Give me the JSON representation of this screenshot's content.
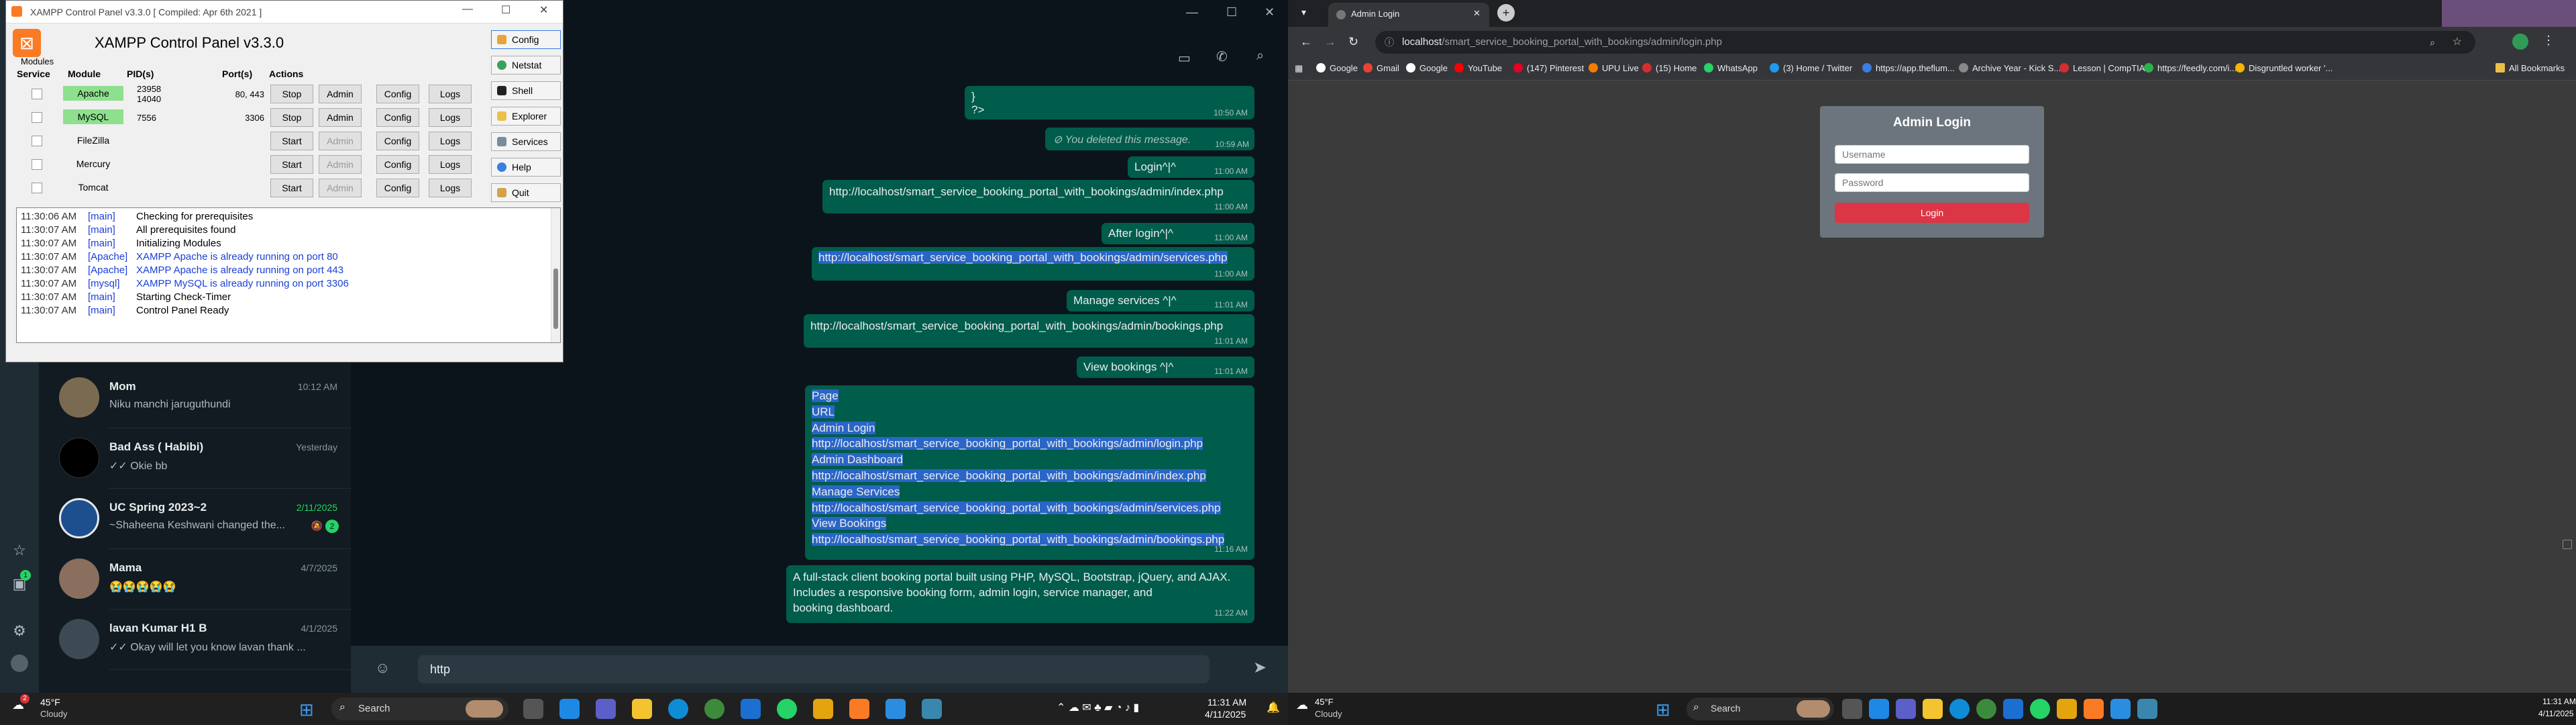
{
  "whatsapp": {
    "rail_badge": "1",
    "chats": [
      {
        "name": "Mom",
        "preview": "Niku manchi jaruguthundi",
        "time": "10:12 AM"
      },
      {
        "name": "Bad Ass ( Habibi)",
        "preview": "✓✓ Okie bb",
        "time": "Yesterday"
      },
      {
        "name": "UC Spring 2023~2",
        "preview": "~Shaheena Keshwani changed the...",
        "time": "2/11/2025",
        "badge": "2"
      },
      {
        "name": "Mama",
        "preview": "😭😭😭😭😭",
        "time": "4/7/2025"
      },
      {
        "name": "lavan Kumar H1 B",
        "preview": "✓✓ Okay will let you know lavan thank ...",
        "time": "4/1/2025"
      }
    ],
    "messages": {
      "m0_line1": "}",
      "m0_line2": "?>",
      "m0_time": "10:50 AM",
      "deleted": "You deleted this message.",
      "deleted_time": "10:59 AM",
      "m1": "Login^|^",
      "m1_time": "11:00 AM",
      "m2": "http://localhost/smart_service_booking_portal_with_bookings/admin/index.php",
      "m2_time": "11:00 AM",
      "m3": "After login^|^",
      "m3_time": "11:00 AM",
      "m4": "http://localhost/smart_service_booking_portal_with_bookings/admin/services.php",
      "m4_time": "11:00 AM",
      "m5": "Manage services ^|^",
      "m5_time": "11:01 AM",
      "m6": "http://localhost/smart_service_booking_portal_with_bookings/admin/bookings.php",
      "m6_time": "11:01 AM",
      "m7": "View bookings ^|^",
      "m7_time": "11:01 AM",
      "m8_lines": [
        "Page",
        "URL",
        "Admin Login",
        "http://localhost/smart_service_booking_portal_with_bookings/admin/login.php",
        "Admin Dashboard",
        "http://localhost/smart_service_booking_portal_with_bookings/admin/index.php",
        "Manage Services",
        "http://localhost/smart_service_booking_portal_with_bookings/admin/services.php",
        "View Bookings",
        "http://localhost/smart_service_booking_portal_with_bookings/admin/bookings.php"
      ],
      "m8_time": "11:16 AM",
      "m9_lines": [
        "A full-stack client booking portal built using PHP, MySQL, Bootstrap, jQuery, and AJAX.",
        "Includes a responsive booking form, admin login, service manager, and",
        "booking dashboard."
      ],
      "m9_time": "11:22 AM"
    },
    "input_value": "http"
  },
  "xampp": {
    "window_title": "XAMPP Control Panel v3.3.0   [ Compiled: Apr 6th 2021 ]",
    "heading": "XAMPP Control Panel v3.3.0",
    "modules_label": "Modules",
    "col_service": "Service",
    "col_module": "Module",
    "col_pids": "PID(s)",
    "col_ports": "Port(s)",
    "col_actions": "Actions",
    "rows": [
      {
        "module": "Apache",
        "pid1": "23958",
        "pid2": "14040",
        "ports": "80, 443",
        "action": "Stop",
        "admin": "Admin",
        "config": "Config",
        "logs": "Logs"
      },
      {
        "module": "MySQL",
        "pid1": "7556",
        "pid2": "",
        "ports": "3306",
        "action": "Stop",
        "admin": "Admin",
        "config": "Config",
        "logs": "Logs"
      },
      {
        "module": "FileZilla",
        "pid1": "",
        "pid2": "",
        "ports": "",
        "action": "Start",
        "admin": "Admin",
        "config": "Config",
        "logs": "Logs"
      },
      {
        "module": "Mercury",
        "pid1": "",
        "pid2": "",
        "ports": "",
        "action": "Start",
        "admin": "Admin",
        "config": "Config",
        "logs": "Logs"
      },
      {
        "module": "Tomcat",
        "pid1": "",
        "pid2": "",
        "ports": "",
        "action": "Start",
        "admin": "Admin",
        "config": "Config",
        "logs": "Logs"
      }
    ],
    "side": [
      "Config",
      "Netstat",
      "Shell",
      "Explorer",
      "Services",
      "Help",
      "Quit"
    ],
    "log": [
      {
        "time": "11:30:06 AM",
        "mod": "[main]",
        "msg": "Checking for prerequisites",
        "color": "#000000"
      },
      {
        "time": "11:30:07 AM",
        "mod": "[main]",
        "msg": "All prerequisites found",
        "color": "#000000"
      },
      {
        "time": "11:30:07 AM",
        "mod": "[main]",
        "msg": "Initializing Modules",
        "color": "#000000"
      },
      {
        "time": "11:30:07 AM",
        "mod": "[Apache]",
        "msg": "XAMPP Apache is already running on port 80",
        "color": "#1a3fd6"
      },
      {
        "time": "11:30:07 AM",
        "mod": "[Apache]",
        "msg": "XAMPP Apache is already running on port 443",
        "color": "#1a3fd6"
      },
      {
        "time": "11:30:07 AM",
        "mod": "[mysql]",
        "msg": "XAMPP MySQL is already running on port 3306",
        "color": "#1a3fd6"
      },
      {
        "time": "11:30:07 AM",
        "mod": "[main]",
        "msg": "Starting Check-Timer",
        "color": "#000000"
      },
      {
        "time": "11:30:07 AM",
        "mod": "[main]",
        "msg": "Control Panel Ready",
        "color": "#000000"
      }
    ]
  },
  "taskbar1": {
    "temp": "45°F",
    "weather": "Cloudy",
    "search": "Search",
    "time": "11:31 AM",
    "date": "4/11/2025",
    "weather_badge": "2"
  },
  "taskbar2": {
    "temp": "45°F",
    "weather": "Cloudy",
    "search": "Search",
    "time": "11:31 AM",
    "date": "4/11/2025"
  },
  "chrome": {
    "tab_title": "Admin Login",
    "url_host": "localhost",
    "url_path": "/smart_service_booking_portal_with_bookings/admin/login.php",
    "bookmarks": [
      "Google",
      "Gmail",
      "Google",
      "YouTube",
      "(147) Pinterest",
      "UPU Live",
      "(15) Home",
      "WhatsApp",
      "(3) Home / Twitter",
      "https://app.theflum...",
      "Archive Year - Kick S...",
      "Lesson | CompTIA",
      "https://feedly.com/i...",
      "Disgruntled worker '...",
      "All Bookmarks"
    ],
    "login": {
      "title": "Admin Login",
      "username_placeholder": "Username",
      "password_placeholder": "Password",
      "button": "Login"
    }
  }
}
